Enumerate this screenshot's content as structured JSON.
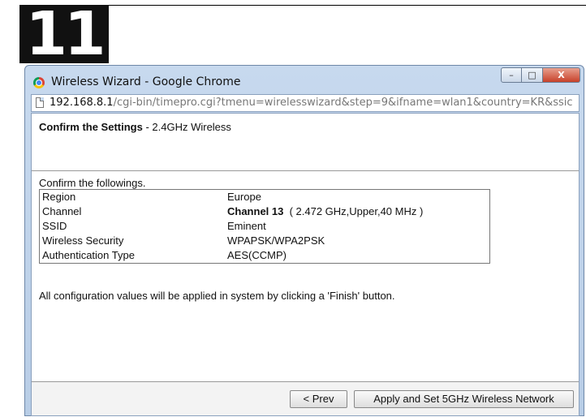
{
  "step_number": "11",
  "window": {
    "title": "Wireless Wizard - Google Chrome",
    "controls": {
      "minimize": "–",
      "maximize": "□",
      "close": "X"
    }
  },
  "address": {
    "host": "192.168.8.1",
    "path": "/cgi-bin/timepro.cgi?tmenu=wirelesswizard&step=9&ifname=wlan1&country=KR&ssic"
  },
  "header": {
    "title_bold": "Confirm the Settings",
    "title_rest": " - 2.4GHz Wireless"
  },
  "intro": "Confirm the followings.",
  "settings": [
    {
      "label": "Region",
      "value_bold": "",
      "value": "Europe"
    },
    {
      "label": "Channel",
      "value_bold": "Channel 13",
      "value": "  ( 2.472 GHz,Upper,40 MHz )"
    },
    {
      "label": "SSID",
      "value_bold": "",
      "value": "Eminent"
    },
    {
      "label": "Wireless Security",
      "value_bold": "",
      "value": "WPAPSK/WPA2PSK"
    },
    {
      "label": "Authentication Type",
      "value_bold": "",
      "value": "AES(CCMP)"
    }
  ],
  "note": "All configuration values will be applied in system by clicking a 'Finish' button.",
  "buttons": {
    "prev": "< Prev",
    "apply": "Apply and Set 5GHz Wireless Network"
  }
}
